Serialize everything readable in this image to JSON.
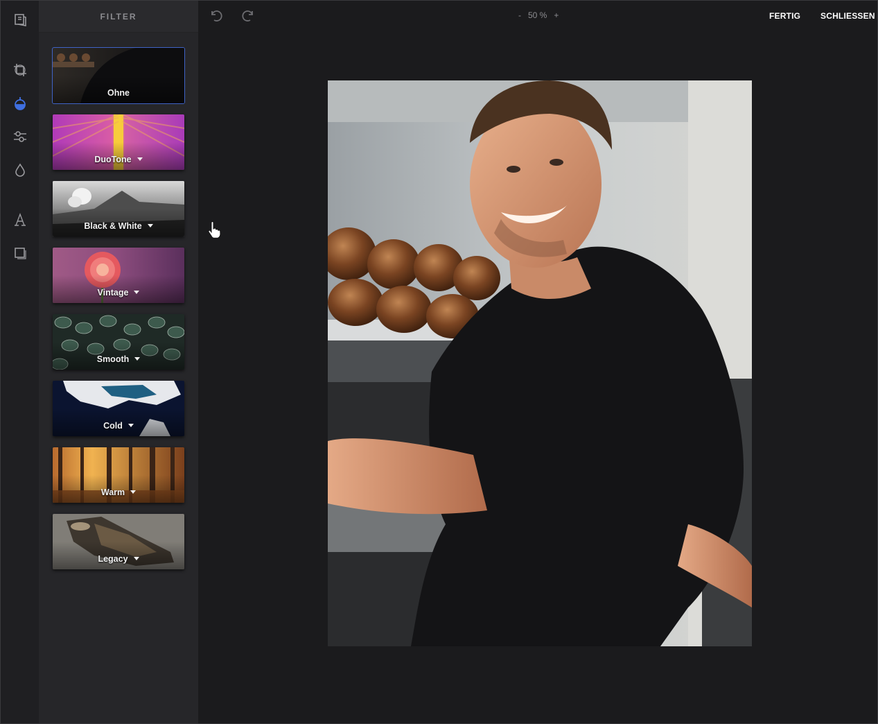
{
  "panel": {
    "title": "FILTER"
  },
  "filters": [
    {
      "label": "Ohne",
      "has_menu": false,
      "selected": true
    },
    {
      "label": "DuoTone",
      "has_menu": true,
      "selected": false
    },
    {
      "label": "Black & White",
      "has_menu": true,
      "selected": false
    },
    {
      "label": "Vintage",
      "has_menu": true,
      "selected": false
    },
    {
      "label": "Smooth",
      "has_menu": true,
      "selected": false
    },
    {
      "label": "Cold",
      "has_menu": true,
      "selected": false
    },
    {
      "label": "Warm",
      "has_menu": true,
      "selected": false
    },
    {
      "label": "Legacy",
      "has_menu": true,
      "selected": false
    }
  ],
  "toolbar": {
    "zoom_minus": "-",
    "zoom_value": "50 %",
    "zoom_plus": "+",
    "done_label": "FERTIG",
    "close_label": "SCHLIESSEN"
  },
  "rail": {
    "icons": [
      "library-icon",
      "crop-icon",
      "filter-icon",
      "adjust-icon",
      "focus-icon",
      "text-icon",
      "frame-icon"
    ],
    "active": "filter-icon"
  },
  "colors": {
    "accent": "#3f6fe0",
    "background": "#1b1b1d",
    "panel": "#262629"
  }
}
